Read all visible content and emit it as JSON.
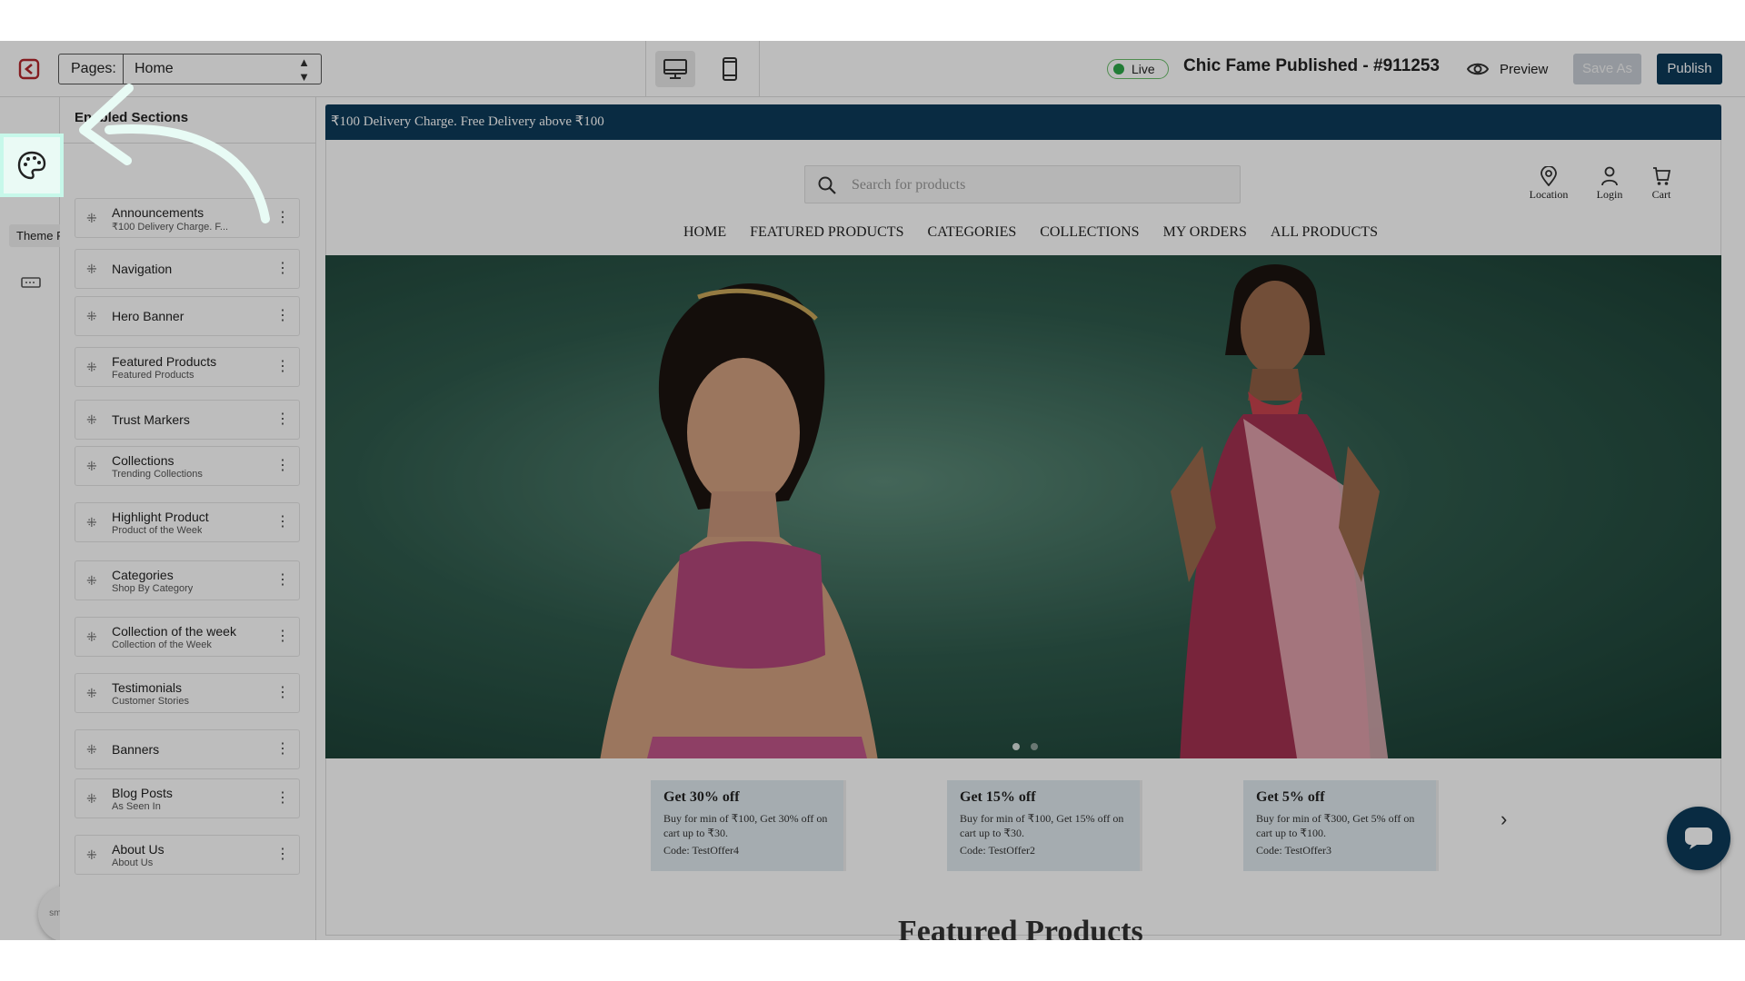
{
  "topbar": {
    "pages_label": "Pages:",
    "page_selected": "Home",
    "live_label": "Live",
    "store_title": "Chic Fame Published - #911253",
    "preview_label": "Preview",
    "save_as_label": "Save As",
    "publish_label": "Publish"
  },
  "sidebar": {
    "tooltip": "Theme Properties",
    "panel_title": "Enabled Sections",
    "brand_badge": "smartbiz",
    "help_label": "?",
    "sections": [
      {
        "label": "Announcements",
        "sub": "₹100 Delivery Charge. F..."
      },
      {
        "label": "Navigation",
        "sub": ""
      },
      {
        "label": "Hero Banner",
        "sub": ""
      },
      {
        "label": "Featured Products",
        "sub": "Featured Products"
      },
      {
        "label": "Trust Markers",
        "sub": ""
      },
      {
        "label": "Collections",
        "sub": "Trending Collections"
      },
      {
        "label": "Highlight Product",
        "sub": "Product of the Week"
      },
      {
        "label": "Categories",
        "sub": "Shop By Category"
      },
      {
        "label": "Collection of the week",
        "sub": "Collection of the Week"
      },
      {
        "label": "Testimonials",
        "sub": "Customer Stories"
      },
      {
        "label": "Banners",
        "sub": ""
      },
      {
        "label": "Blog Posts",
        "sub": "As Seen In"
      },
      {
        "label": "About Us",
        "sub": "About Us"
      }
    ]
  },
  "store": {
    "announcement": "₹100 Delivery Charge. Free Delivery above ₹100",
    "search_placeholder": "Search for products",
    "location_label": "Location",
    "login_label": "Login",
    "cart_label": "Cart",
    "nav": [
      "HOME",
      "FEATURED PRODUCTS",
      "CATEGORIES",
      "COLLECTIONS",
      "MY ORDERS",
      "ALL PRODUCTS"
    ],
    "offers": [
      {
        "title": "Get 30% off",
        "desc": "Buy for min of ₹100, Get 30% off on cart up to ₹30.",
        "code": "Code: TestOffer4"
      },
      {
        "title": "Get 15% off",
        "desc": "Buy for min of ₹100, Get 15% off on cart up to ₹30.",
        "code": "Code: TestOffer2"
      },
      {
        "title": "Get 5% off",
        "desc": "Buy for min of ₹300, Get 5% off on cart up to ₹100.",
        "code": "Code: TestOffer3"
      }
    ],
    "featured_heading": "Featured Products",
    "hero_active_slide": 1,
    "hero_slide_count": 2
  },
  "colors": {
    "brand_dark": "#0d3b5a",
    "live_green": "#2ea84a",
    "highlight_mint": "#c7f8ea"
  },
  "icons": [
    "app-logo-icon",
    "desktop-icon",
    "mobile-icon",
    "eye-icon",
    "palette-icon",
    "pages-icon",
    "sections-icon",
    "search-icon",
    "location-pin-icon",
    "user-icon",
    "cart-icon",
    "chevron-right-icon",
    "chat-icon",
    "drag-handle-icon",
    "more-vertical-icon",
    "arrow-pointer-icon"
  ]
}
